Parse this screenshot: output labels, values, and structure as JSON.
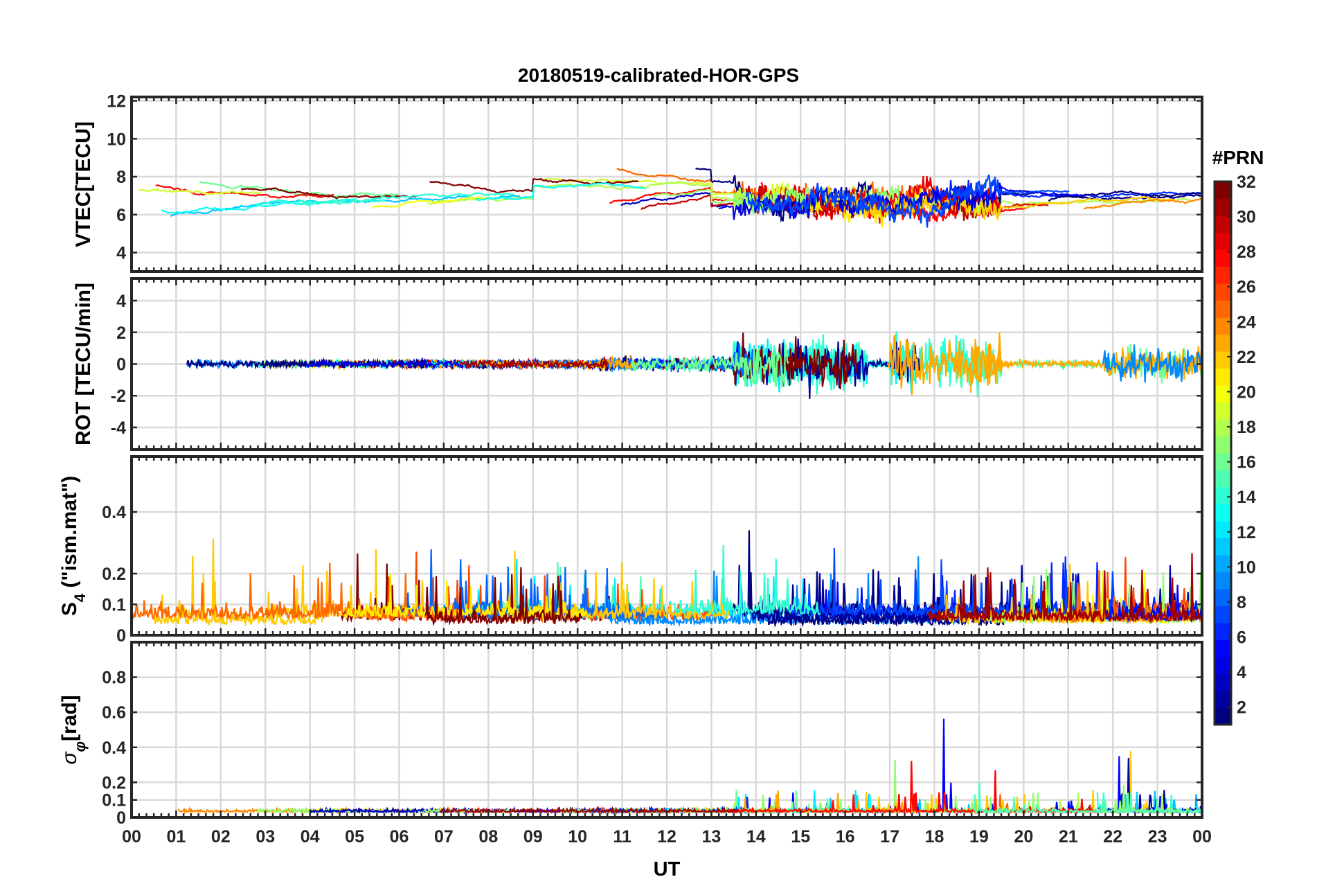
{
  "chart_data": {
    "type": "line",
    "title": "20180519-calibrated-HOR-GPS",
    "xlabel": "UT",
    "x_ticks": [
      "00",
      "01",
      "02",
      "03",
      "04",
      "05",
      "06",
      "07",
      "08",
      "09",
      "10",
      "11",
      "12",
      "13",
      "14",
      "15",
      "16",
      "17",
      "18",
      "19",
      "20",
      "21",
      "22",
      "23",
      "00"
    ],
    "xlim": [
      0,
      24
    ],
    "grid": true,
    "colorbar": {
      "label": "#PRN",
      "colormap": "jet",
      "range": [
        1,
        32
      ],
      "ticks": [
        "32",
        "30",
        "28",
        "26",
        "24",
        "22",
        "20",
        "18",
        "16",
        "14",
        "12",
        "10",
        "8",
        "6",
        "4",
        "2"
      ]
    },
    "panels": [
      {
        "id": "vtec",
        "ylabel": "VTEC[TECU]",
        "ylim": [
          3,
          12.2
        ],
        "y_ticks": [
          "12",
          "10",
          "8",
          "6",
          "4"
        ],
        "note_series": "multiple PRN traces, values roughly 4–12 TECU, mostly 6–8"
      },
      {
        "id": "rot",
        "ylabel": "ROT [TECU/min]",
        "ylim": [
          -5.4,
          5.4
        ],
        "y_ticks": [
          "4",
          "2",
          "0",
          "-2",
          "-4"
        ]
      },
      {
        "id": "s4",
        "ylabel": "S4 (\"ism.mat\")",
        "ylabel_main": "S",
        "ylabel_sub": "4",
        "ylabel_rest": " (\"ism.mat\")",
        "ylim": [
          0,
          0.58
        ],
        "y_ticks": [
          "0.4",
          "0.2",
          "0.1",
          "0"
        ]
      },
      {
        "id": "sigma",
        "ylabel": "σφ[rad]",
        "ylabel_main": "σ",
        "ylabel_sub": "φ",
        "ylabel_rest": "[rad]",
        "ylim": [
          0,
          1.0
        ],
        "y_ticks": [
          "0.8",
          "0.6",
          "0.4",
          "0.2",
          "0.1",
          "0"
        ]
      }
    ]
  }
}
